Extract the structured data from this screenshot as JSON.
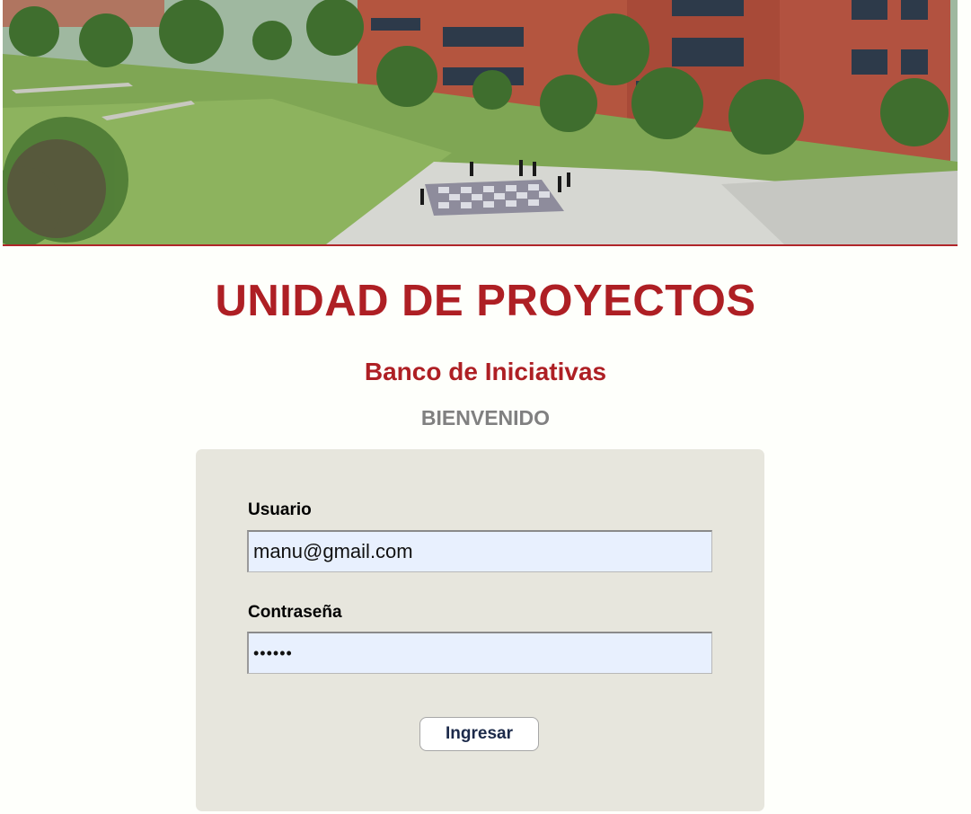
{
  "header": {
    "title": "UNIDAD DE PROYECTOS",
    "subtitle": "Banco de Iniciativas",
    "welcome": "BIENVENIDO"
  },
  "login": {
    "user_label": "Usuario",
    "user_value": "manu@gmail.com",
    "password_label": "Contraseña",
    "password_value": "••••••",
    "submit_label": "Ingresar"
  },
  "colors": {
    "accent": "#ae1f24",
    "panel": "#e7e6dd",
    "input_bg": "#e8f0fe",
    "muted": "#808080"
  }
}
